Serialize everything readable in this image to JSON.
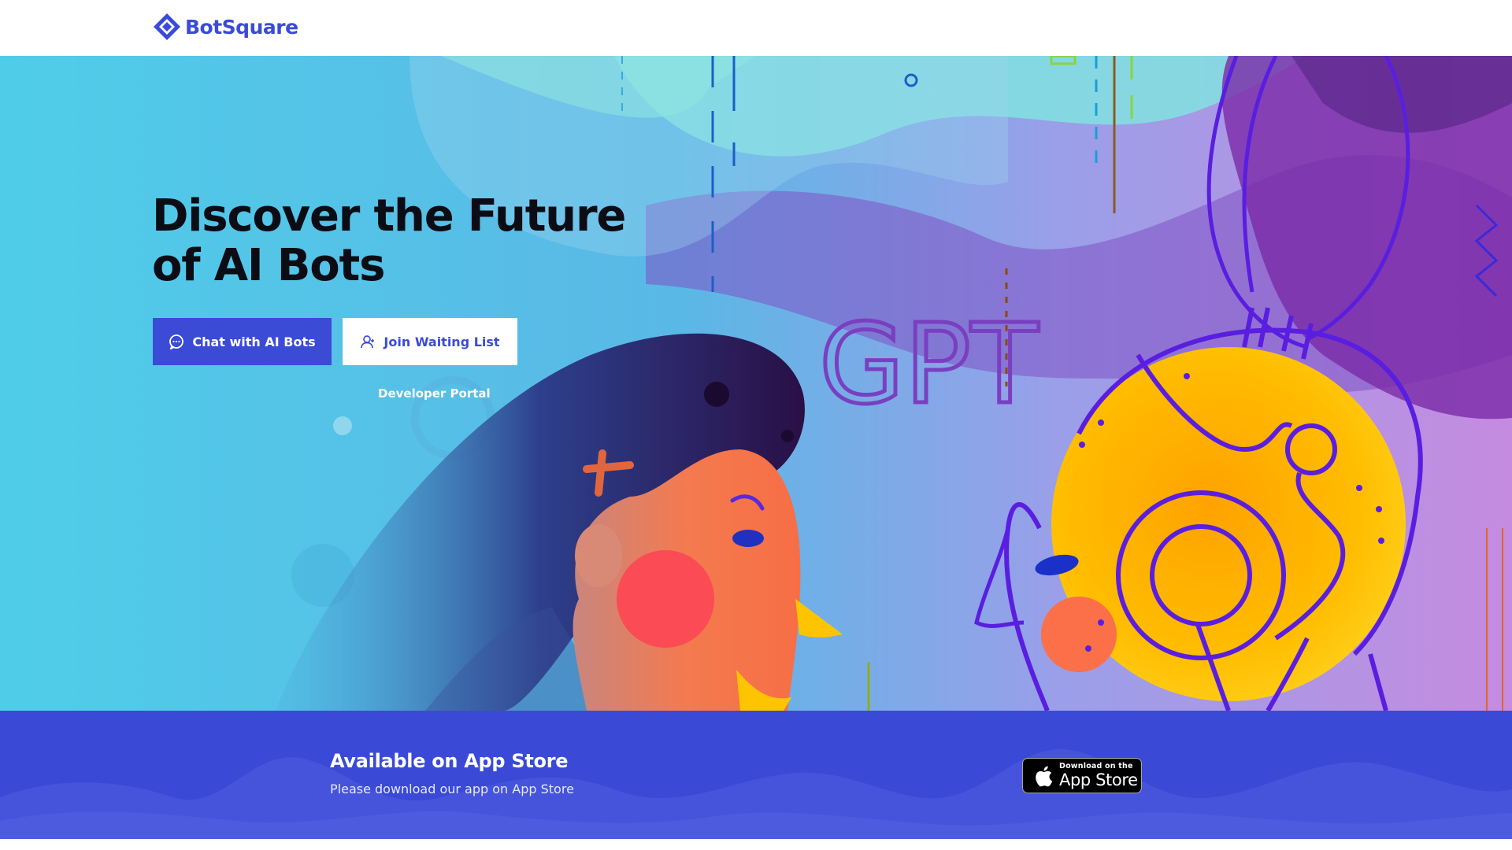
{
  "header": {
    "brand": "BotSquare",
    "brand_color": "#3a4bd8",
    "logo_icon": "diamond-logo-icon"
  },
  "hero": {
    "title_line1": "Discover the Future",
    "title_line2": "of AI Bots",
    "art_text": "GPT",
    "primary_button": {
      "label": "Chat with AI Bots",
      "icon": "chat-bubble-icon"
    },
    "secondary_button": {
      "label": "Join Waiting List",
      "icon": "user-icon"
    },
    "developer_link": "Developer Portal",
    "colors": {
      "primary": "#3b4bd6",
      "background": "#4ecde6",
      "purple": "#7a2fb0",
      "orange": "#f97a4a",
      "yellow": "#ffc400"
    }
  },
  "app_band": {
    "title": "Available on App Store",
    "subtitle": "Please download our app on App Store",
    "badge": {
      "small": "Download on the",
      "big": "App Store",
      "icon": "apple-icon"
    },
    "color": "#3a4ad6"
  }
}
